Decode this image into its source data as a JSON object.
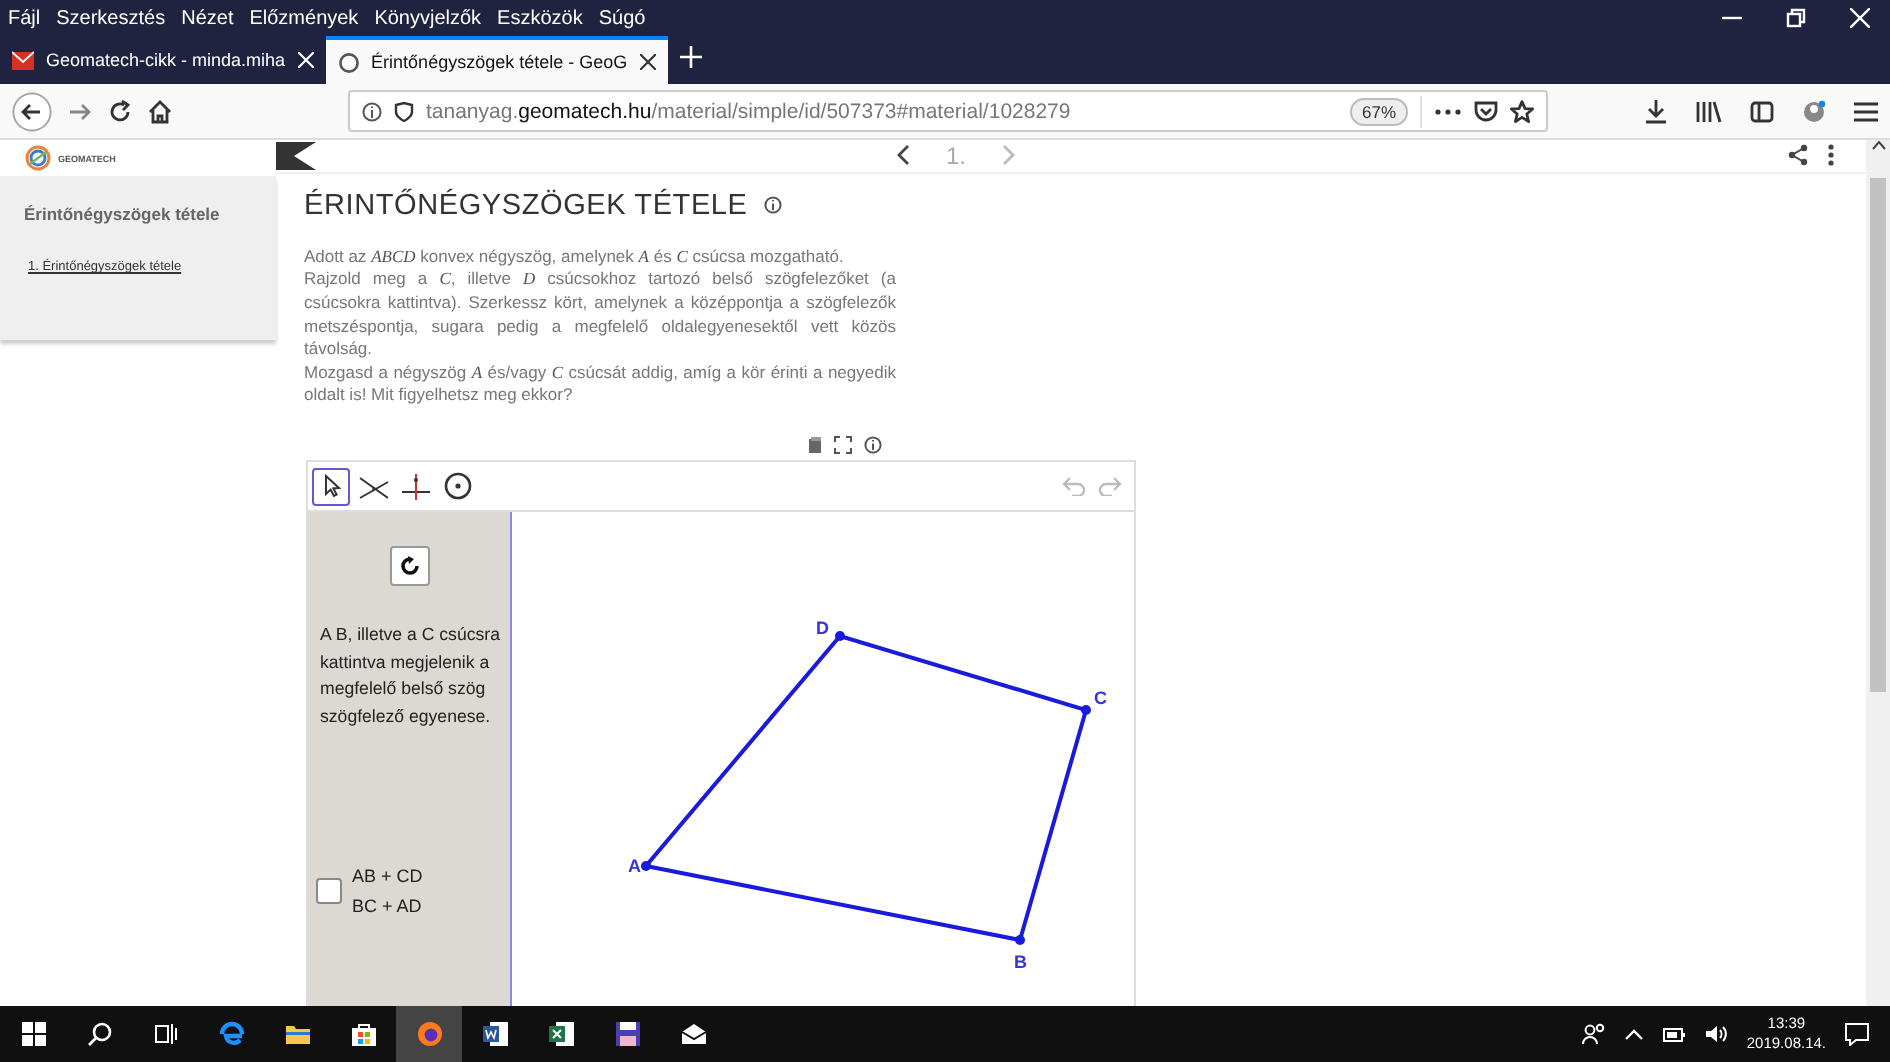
{
  "menu_bar": [
    "Fájl",
    "Szerkesztés",
    "Nézet",
    "Előzmények",
    "Könyvjelzők",
    "Eszközök",
    "Súgó"
  ],
  "tabs": [
    {
      "title": "Geomatech-cikk - minda.miha",
      "selected": false,
      "kind": "mail"
    },
    {
      "title": "Érintőnégyszögek tétele - GeoG",
      "selected": true,
      "kind": "page"
    }
  ],
  "address_bar": {
    "url": {
      "prefix": "tananyag.",
      "domain": "geomatech.hu",
      "path": "/material/simple/id/507373#material/1028279"
    },
    "zoom": "67%"
  },
  "site": {
    "logo": "GEOMATECH",
    "sidebar": {
      "heading": "Érintőnégyszögek tétele",
      "items": [
        {
          "label": "1. Érintőnégyszögek tétele",
          "selected": true
        }
      ]
    },
    "page_number": "1."
  },
  "article": {
    "title": "ÉRINTŐNÉGYSZÖGEK TÉTELE",
    "paragraphs": [
      "Adott az *ABCD* konvex négyszög, amelynek *A* és *C* csúcsa mozgatható.",
      "Rajzold meg a *C*, illetve *D* csúcsokhoz tartozó belső szögfelezőket (a csúcsokra kattintva). Szerkessz kört, amelynek a középpontja a szögfelezők metszéspontja, sugara pedig a megfelelő oldalegyenesektől vett közös távolság.",
      "Mozgasd a négyszög *A* és/vagy *C* csúcsát addig, amíg a kör érinti a negyedik oldalt is! Mit figyelhetsz meg ekkor?"
    ]
  },
  "applet": {
    "tools": [
      {
        "kind": "move",
        "selected": true
      },
      {
        "kind": "bisector",
        "selected": false
      },
      {
        "kind": "perpendicular",
        "selected": false
      },
      {
        "kind": "circle",
        "selected": false
      }
    ],
    "note": "A B, illetve a C csúcsra kattintva megjelenik a megfelelő belső szög szögfelező egyenese.",
    "checkbox": {
      "checked": false,
      "lines": [
        "AB + CD",
        "BC + AD"
      ]
    },
    "points": [
      {
        "label": "A"
      },
      {
        "label": "B"
      },
      {
        "label": "C"
      },
      {
        "label": "D"
      }
    ]
  },
  "taskbar": {
    "apps": [
      {
        "kind": "edge",
        "selected": false
      },
      {
        "kind": "explorer",
        "selected": false
      },
      {
        "kind": "store",
        "selected": false
      },
      {
        "kind": "firefox",
        "selected": true
      },
      {
        "kind": "word",
        "selected": false
      },
      {
        "kind": "excel",
        "selected": false
      },
      {
        "kind": "save",
        "selected": false
      },
      {
        "kind": "mail",
        "selected": false
      }
    ],
    "time": "13:39",
    "date": "2019.08.14."
  }
}
